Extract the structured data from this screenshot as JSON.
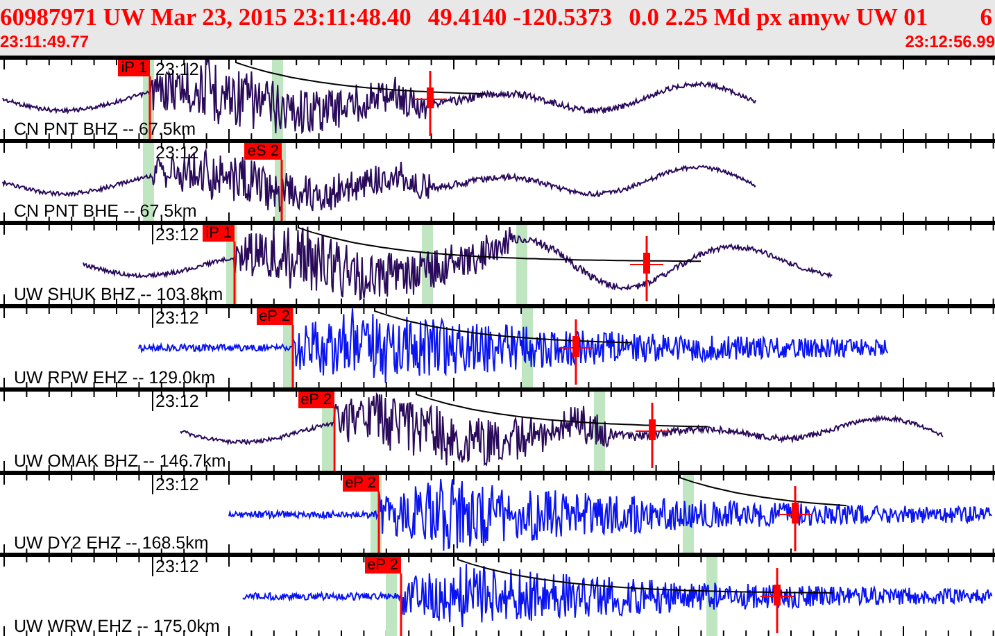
{
  "event_header": {
    "summary": [
      "60987971 UW Mar 23, 2015 23:11:48.40",
      "49.4140 -120.5373",
      "0.0 2.25 Md px amyw UW 01",
      "6"
    ],
    "start_time": "23:11:49.77",
    "end_time": "23:12:56.99"
  },
  "traces": [
    {
      "label": "CN PNT BHZ -- 67.5km",
      "time_mark": "23:12",
      "color": "#2a0a5a",
      "picks": [
        {
          "label": "iP 1"
        }
      ]
    },
    {
      "label": "CN PNT BHE -- 67.5km",
      "time_mark": "23:12",
      "color": "#2a0a5a",
      "picks": [
        {
          "label": "eS 2"
        }
      ]
    },
    {
      "label": "UW SHUK BHZ -- 103.8km",
      "time_mark": "23:12",
      "color": "#2a0a5a",
      "picks": [
        {
          "label": "iP 1"
        }
      ]
    },
    {
      "label": "UW RPW EHZ -- 129.0km",
      "time_mark": "23:12",
      "color": "#0a14f0",
      "picks": [
        {
          "label": "eP 2"
        }
      ]
    },
    {
      "label": "UW OMAK BHZ -- 146.7km",
      "time_mark": "23:12",
      "color": "#2a0a5a",
      "picks": [
        {
          "label": "eP 2"
        }
      ]
    },
    {
      "label": "UW DY2 EHZ -- 168.5km",
      "time_mark": "23:12",
      "color": "#0a14f0",
      "picks": [
        {
          "label": "eP 2"
        }
      ]
    },
    {
      "label": "UW WRW EHZ -- 175.0km",
      "time_mark": "23:12",
      "color": "#0a14f0",
      "picks": [
        {
          "label": "eP 2"
        }
      ]
    }
  ]
}
